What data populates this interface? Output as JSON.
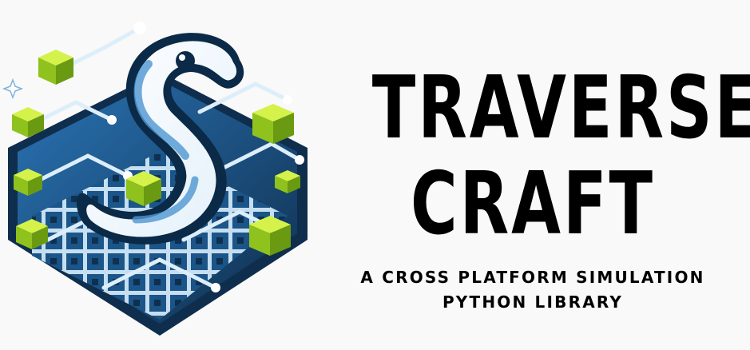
{
  "brand": {
    "title_line_1": "TRAVERSE",
    "title_line_2": "CRAFT",
    "subtitle_line_1": "A CROSS PLATFORM SIMULATION",
    "subtitle_line_2": "PYTHON LIBRARY"
  },
  "logo": {
    "icon": "python-snake-on-grid-icon",
    "colors": {
      "grid_dark": "#0f2e4d",
      "grid_mid": "#1f5f96",
      "grid_light": "#5aa3d8",
      "snake_body": "#ffffff",
      "snake_shade": "#4d96d1",
      "snake_outline": "#0b2a47",
      "cube_top": "#c6ee3b",
      "cube_side": "#8fc21c",
      "cube_dark": "#6a9a12",
      "background": "#f9f9f9",
      "text": "#000000"
    }
  }
}
